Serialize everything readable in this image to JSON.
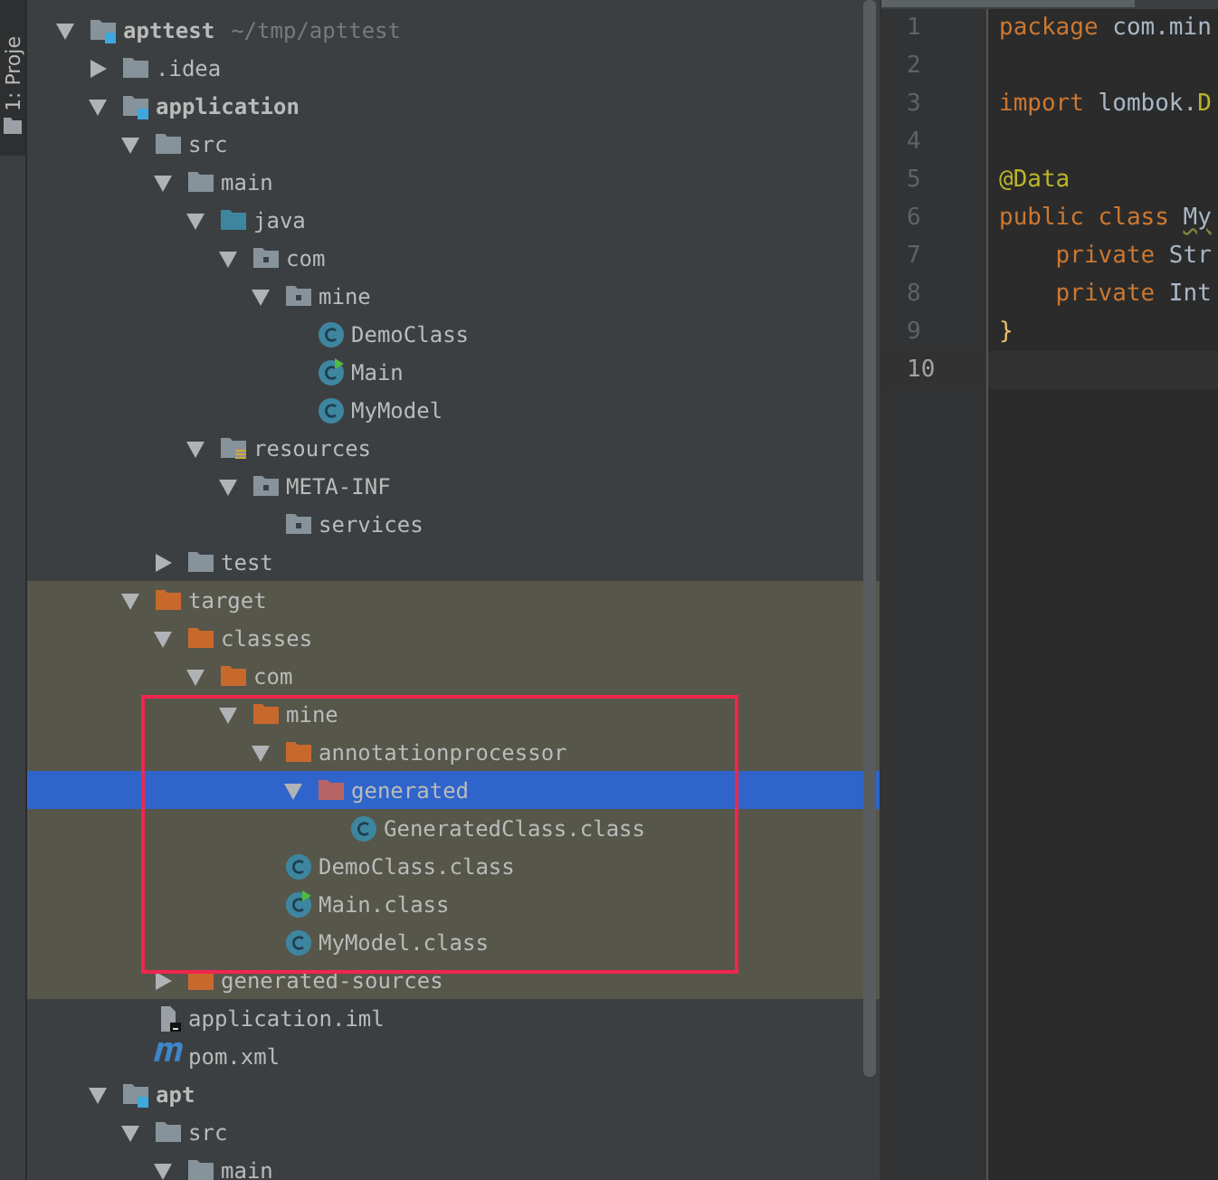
{
  "side_tab": {
    "label": "1: Proje"
  },
  "project_tree": [
    {
      "label": "apttest",
      "hint": "~/tmp/apttest",
      "kind": "module",
      "bold": true,
      "expanded": true,
      "selected": false,
      "excluded": false,
      "children": [
        {
          "label": ".idea",
          "kind": "folder",
          "expanded": false,
          "selected": false,
          "excluded": false
        },
        {
          "label": "application",
          "kind": "module",
          "bold": true,
          "expanded": true,
          "selected": false,
          "excluded": false,
          "children": [
            {
              "label": "src",
              "kind": "folder",
              "expanded": true,
              "selected": false,
              "excluded": false,
              "children": [
                {
                  "label": "main",
                  "kind": "folder",
                  "expanded": true,
                  "selected": false,
                  "excluded": false,
                  "children": [
                    {
                      "label": "java",
                      "kind": "source",
                      "expanded": true,
                      "selected": false,
                      "excluded": false,
                      "children": [
                        {
                          "label": "com",
                          "kind": "package",
                          "expanded": true,
                          "selected": false,
                          "excluded": false,
                          "children": [
                            {
                              "label": "mine",
                              "kind": "package",
                              "expanded": true,
                              "selected": false,
                              "excluded": false,
                              "children": [
                                {
                                  "label": "DemoClass",
                                  "kind": "class",
                                  "selected": false,
                                  "excluded": false
                                },
                                {
                                  "label": "Main",
                                  "kind": "main-class",
                                  "selected": false,
                                  "excluded": false
                                },
                                {
                                  "label": "MyModel",
                                  "kind": "class",
                                  "selected": false,
                                  "excluded": false
                                }
                              ]
                            }
                          ]
                        }
                      ]
                    },
                    {
                      "label": "resources",
                      "kind": "resources",
                      "expanded": true,
                      "selected": false,
                      "excluded": false,
                      "children": [
                        {
                          "label": "META-INF",
                          "kind": "package",
                          "expanded": true,
                          "selected": false,
                          "excluded": false,
                          "children": [
                            {
                              "label": "services",
                              "kind": "package",
                              "selected": false,
                              "excluded": false
                            }
                          ]
                        }
                      ]
                    }
                  ]
                },
                {
                  "label": "test",
                  "kind": "folder",
                  "expanded": false,
                  "selected": false,
                  "excluded": false
                }
              ]
            },
            {
              "label": "target",
              "kind": "excluded",
              "expanded": true,
              "selected": false,
              "excluded": true,
              "children": [
                {
                  "label": "classes",
                  "kind": "excluded",
                  "expanded": true,
                  "selected": false,
                  "excluded": true,
                  "children": [
                    {
                      "label": "com",
                      "kind": "excluded",
                      "expanded": true,
                      "selected": false,
                      "excluded": true,
                      "children": [
                        {
                          "label": "mine",
                          "kind": "excluded",
                          "expanded": true,
                          "selected": false,
                          "excluded": true,
                          "children": [
                            {
                              "label": "annotationprocessor",
                              "kind": "excluded",
                              "expanded": true,
                              "selected": false,
                              "excluded": true,
                              "children": [
                                {
                                  "label": "generated",
                                  "kind": "excluded",
                                  "expanded": true,
                                  "selected": true,
                                  "children": [
                                    {
                                      "label": "GeneratedClass.class",
                                      "kind": "class",
                                      "selected": false,
                                      "excluded": true
                                    }
                                  ]
                                }
                              ]
                            },
                            {
                              "label": "DemoClass.class",
                              "kind": "class",
                              "selected": false,
                              "excluded": true
                            },
                            {
                              "label": "Main.class",
                              "kind": "main-class",
                              "selected": false,
                              "excluded": true
                            },
                            {
                              "label": "MyModel.class",
                              "kind": "class",
                              "selected": false,
                              "excluded": true
                            }
                          ]
                        }
                      ]
                    }
                  ]
                },
                {
                  "label": "generated-sources",
                  "kind": "excluded",
                  "expanded": false,
                  "selected": false,
                  "excluded": true
                }
              ]
            },
            {
              "label": "application.iml",
              "kind": "iml",
              "selected": false,
              "excluded": false
            },
            {
              "label": "pom.xml",
              "kind": "maven",
              "selected": false,
              "excluded": false
            }
          ]
        },
        {
          "label": "apt",
          "kind": "module",
          "bold": true,
          "expanded": true,
          "selected": false,
          "excluded": false,
          "children": [
            {
              "label": "src",
              "kind": "folder",
              "expanded": true,
              "selected": false,
              "excluded": false,
              "children": [
                {
                  "label": "main",
                  "kind": "folder",
                  "expanded": true,
                  "selected": false,
                  "excluded": false
                }
              ]
            }
          ]
        }
      ]
    }
  ],
  "editor": {
    "lines": [
      {
        "number": "1",
        "current": false,
        "tokens": [
          {
            "kind": "keyword",
            "text": "package "
          },
          {
            "kind": "plain",
            "text": "com.min"
          }
        ]
      },
      {
        "number": "2",
        "current": false
      },
      {
        "number": "3",
        "current": false,
        "tokens": [
          {
            "kind": "keyword",
            "text": "import "
          },
          {
            "kind": "plain",
            "text": "lombok."
          },
          {
            "kind": "annotation",
            "text": "D"
          }
        ]
      },
      {
        "number": "4",
        "current": false
      },
      {
        "number": "5",
        "current": false,
        "tokens": [
          {
            "kind": "annotation",
            "text": "@Data"
          }
        ]
      },
      {
        "number": "6",
        "current": false,
        "tokens": [
          {
            "kind": "keyword",
            "text": "public class "
          },
          {
            "kind": "warning",
            "text": "My"
          }
        ]
      },
      {
        "number": "7",
        "current": false,
        "tokens": [
          {
            "kind": "keyword",
            "text": "    private "
          },
          {
            "kind": "plain",
            "text": "Str"
          }
        ]
      },
      {
        "number": "8",
        "current": false,
        "tokens": [
          {
            "kind": "keyword",
            "text": "    private "
          },
          {
            "kind": "plain",
            "text": "Int"
          }
        ]
      },
      {
        "number": "9",
        "current": false,
        "tokens": [
          {
            "kind": "brace",
            "text": "}"
          }
        ]
      },
      {
        "number": "10",
        "current": true
      }
    ]
  }
}
